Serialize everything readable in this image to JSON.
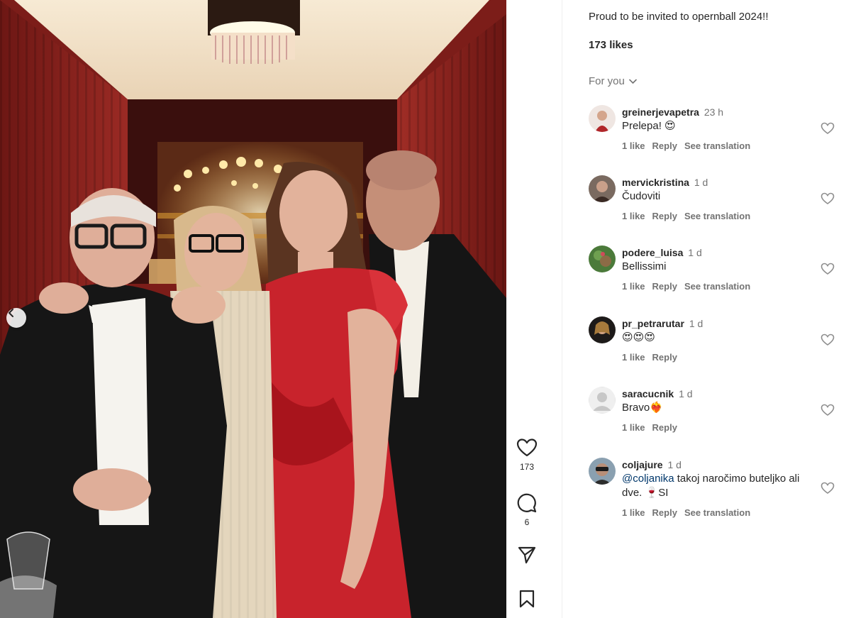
{
  "post": {
    "caption": "Proud to be invited to opernball 2024!!",
    "likes_text": "173 likes",
    "for_you_label": "For you"
  },
  "actions": {
    "like_count": "173",
    "comment_count": "6"
  },
  "comments": [
    {
      "username": "greinerjevapetra",
      "time": "23 h",
      "text": "Prelepa! 😍",
      "likes": "1 like",
      "reply": "Reply",
      "translate": "See translation"
    },
    {
      "username": "mervickristina",
      "time": "1 d",
      "text": "Čudoviti",
      "likes": "1 like",
      "reply": "Reply",
      "translate": "See translation"
    },
    {
      "username": "podere_luisa",
      "time": "1 d",
      "text": "Bellissimi",
      "likes": "1 like",
      "reply": "Reply",
      "translate": "See translation"
    },
    {
      "username": "pr_petrarutar",
      "time": "1 d",
      "text": "😍😍😍",
      "likes": "1 like",
      "reply": "Reply"
    },
    {
      "username": "saracucnik",
      "time": "1 d",
      "text": "Bravo❤️‍🔥",
      "likes": "1 like",
      "reply": "Reply"
    },
    {
      "username": "coljajure",
      "time": "1 d",
      "mention": "@coljanika",
      "text": " takoj naročimo buteljko ali dve. 🍷SI",
      "likes": "1 like",
      "reply": "Reply",
      "translate": "See translation"
    }
  ],
  "colors": {
    "text": "#262626",
    "secondary": "#737373",
    "mention": "#00376b",
    "divider": "#efefef",
    "curtain_red": "#8e2420",
    "dress_red": "#c8232c"
  },
  "icons": [
    "chevron-left-icon",
    "heart-icon",
    "comment-icon",
    "share-icon",
    "bookmark-icon",
    "chevron-down-icon"
  ]
}
